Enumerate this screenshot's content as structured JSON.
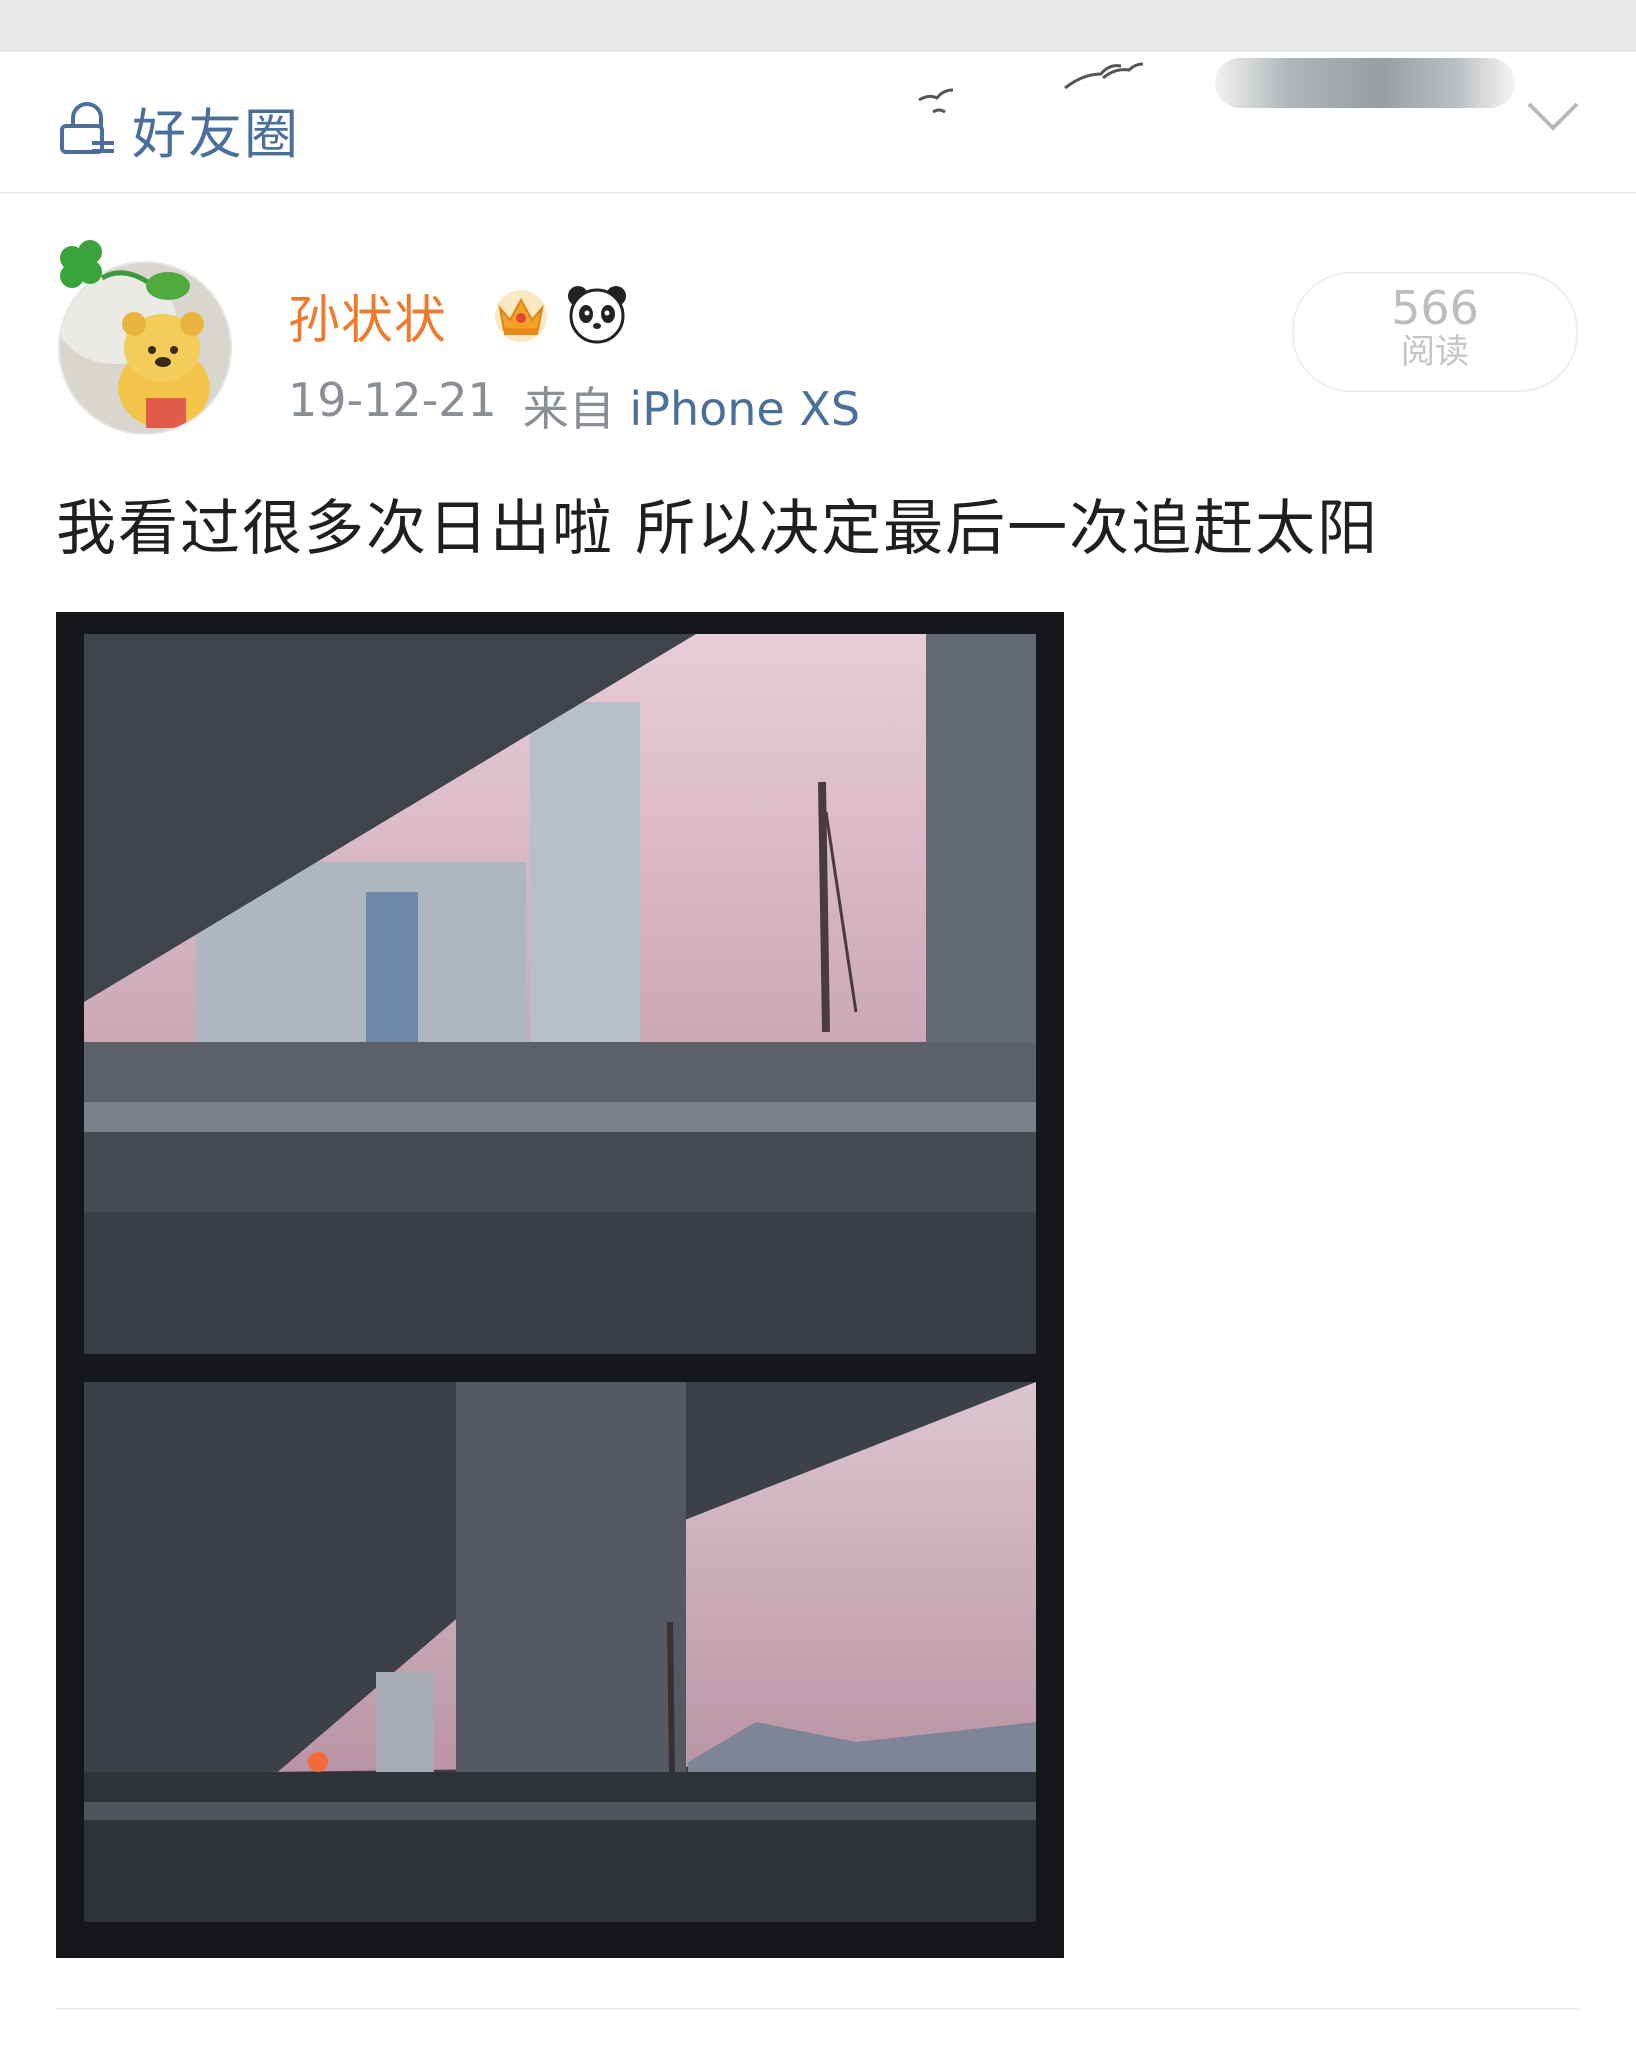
{
  "header": {
    "visibility_label": "好友圈",
    "visibility_icon": "lock-icon",
    "decoration_icon": "birds-icon",
    "dropdown_icon": "chevron-down-icon"
  },
  "post": {
    "author": "孙状状",
    "badges": [
      "crown-icon",
      "panda-icon"
    ],
    "date": "19-12-21",
    "source_prefix": "来自",
    "device": "iPhone XS",
    "read_count": "566",
    "read_label": "阅读",
    "text": "我看过很多次日出啦 所以决定最后一次追赶太阳"
  },
  "colors": {
    "author": "#ee7a2f",
    "link": "#4b6f9b",
    "meta": "#8a8f95",
    "text": "#1f1f1f"
  }
}
